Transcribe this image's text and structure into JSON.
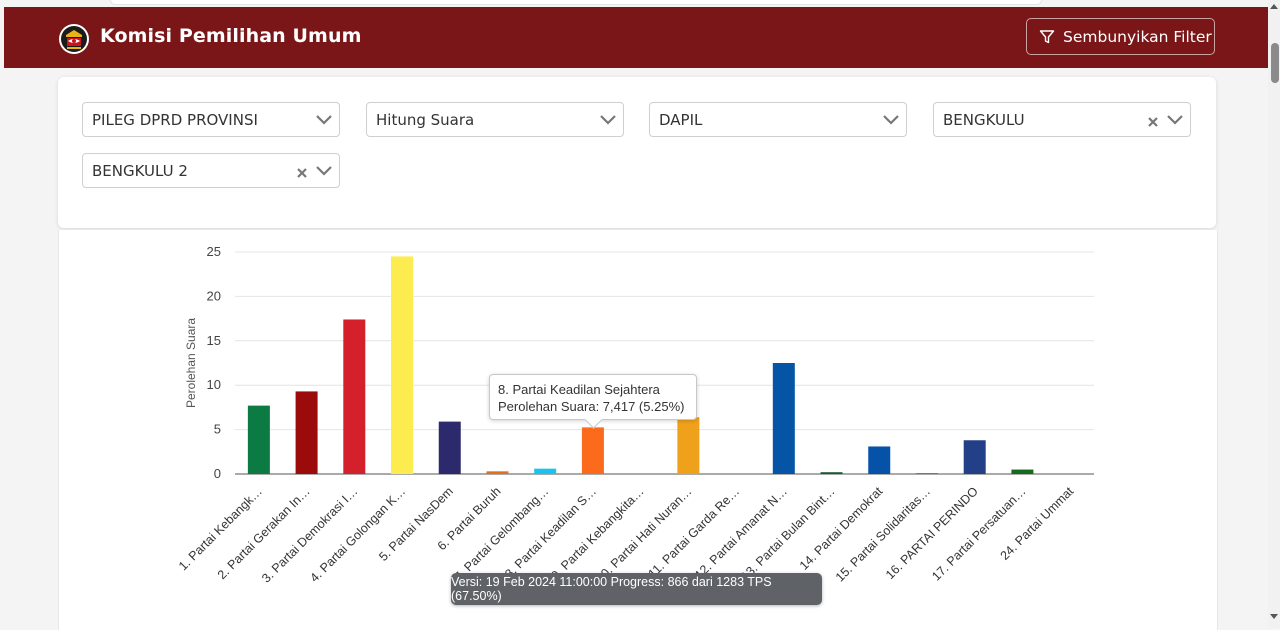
{
  "header": {
    "brand": "Komisi Pemilihan Umum",
    "filter_button_label": "Sembunyikan Filter",
    "background_color": "#7a1617"
  },
  "filters": [
    {
      "value": "PILEG DPRD PROVINSI",
      "clearable": false
    },
    {
      "value": "Hitung Suara",
      "clearable": false
    },
    {
      "value": "DAPIL",
      "clearable": false
    },
    {
      "value": "BENGKULU",
      "clearable": true
    },
    {
      "value": "BENGKULU 2",
      "clearable": true
    }
  ],
  "chart_data": {
    "type": "bar",
    "ylabel": "Perolehan Suara",
    "ylim": [
      0,
      25
    ],
    "yticks": [
      0,
      5,
      10,
      15,
      20,
      25
    ],
    "grid": true,
    "categories": [
      "1. Partai Kebangk…",
      "2. Partai Gerakan In…",
      "3. Partai Demokrasi I…",
      "4. Partai Golongan K…",
      "5. Partai NasDem",
      "6. Partai Buruh",
      "7. Partai Gelombang…",
      "8. Partai Keadilan S…",
      "9. Partai Kebangkita…",
      "10. Partai Hati Nuran…",
      "11. Partai Garda Re…",
      "12. Partai Amanat N…",
      "13. Partai Bulan Bint…",
      "14. Partai Demokrat",
      "15. Partai Solidaritas…",
      "16. PARTAI PERINDO",
      "17. Partai Persatuan…",
      "24. Partai Ummat"
    ],
    "values": [
      7.7,
      9.3,
      17.4,
      24.5,
      5.9,
      0.3,
      0.6,
      5.25,
      0,
      6.4,
      0,
      12.5,
      0.2,
      3.1,
      0.1,
      3.8,
      0.5,
      0
    ],
    "colors": [
      "#0b7a43",
      "#9b0b0b",
      "#d4202a",
      "#fcec4f",
      "#2c2a6c",
      "#e46e1c",
      "#19c3f0",
      "#fb6b1b",
      "#0a6b2e",
      "#f0a11b",
      "#7a1520",
      "#0654a6",
      "#125a2e",
      "#0652a8",
      "#d23a2a",
      "#233f88",
      "#146b1b",
      "#1a6b3a"
    ],
    "highlight_index": 7,
    "tooltip": {
      "title": "8. Partai Keadilan Sejahtera",
      "line": "Perolehan Suara: 7,417 (5.25%)"
    }
  },
  "footer": {
    "version_text": "Versi: 19 Feb 2024 11:00:00 Progress: 866 dari 1283 TPS (67.50%)"
  },
  "icons": {
    "logo": "kpu-logo-icon",
    "filter": "funnel-icon",
    "dropdown": "chevron-down-icon",
    "clear": "close-icon"
  }
}
